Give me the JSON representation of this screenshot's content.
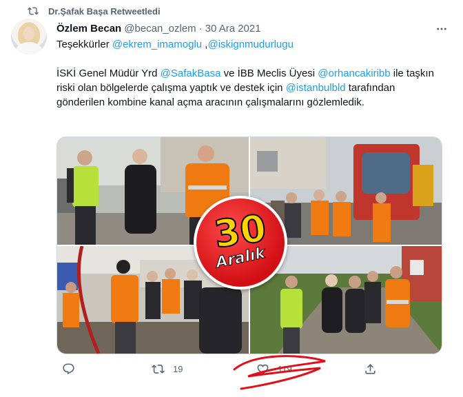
{
  "retweet": {
    "label": "Dr.Şafak Başa Retweetledi"
  },
  "tweet": {
    "author_name": "Özlem Becan",
    "handle": "@becan_ozlem",
    "separator": "·",
    "date": "30 Ara 2021",
    "line1": {
      "prefix": "Teşekkürler ",
      "mention1": "@ekrem_imamoglu",
      "middle": " ,",
      "mention2": "@iskignmudurlugu"
    },
    "body": {
      "t1": "İSKİ Genel Müdür Yrd ",
      "m1": "@SafakBasa",
      "t2": " ve İBB Meclis Üyesi ",
      "m2": "@orhancakiribb",
      "t3": " ile taşkın riski olan bölgelerde çalışma yaptık ve destek için ",
      "m3": "@istanbulbld",
      "t4": " tarafından gönderilen kombine kanal açma aracının çalışmalarını gözlemledik."
    },
    "badge": {
      "number": "30",
      "word": "Aralık"
    }
  },
  "actions": {
    "reply_icon": "reply-icon",
    "retweet_count": "19",
    "like_count": "119",
    "share_icon": "share-icon"
  },
  "colors": {
    "link": "#1d9bf0",
    "muted": "#536471",
    "badge": "#d10f14",
    "scribble": "#e0101a"
  }
}
